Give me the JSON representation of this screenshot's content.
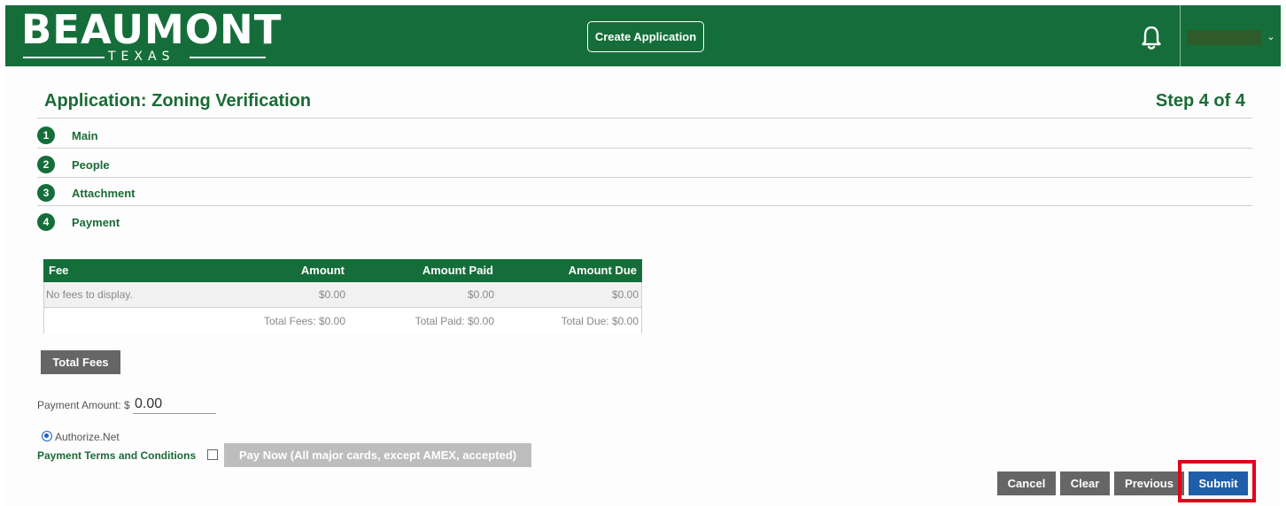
{
  "header": {
    "logo_word": "BEAUMONT",
    "logo_sub": "TEXAS",
    "create_label": "Create Application",
    "user_caret": "⌄"
  },
  "title": {
    "application": "Application: Zoning Verification",
    "step_count": "Step 4 of 4"
  },
  "steps": [
    {
      "number": "1",
      "label": "Main"
    },
    {
      "number": "2",
      "label": "People"
    },
    {
      "number": "3",
      "label": "Attachment"
    },
    {
      "number": "4",
      "label": "Payment"
    }
  ],
  "fees": {
    "columns": [
      "Fee",
      "Amount",
      "Amount Paid",
      "Amount Due"
    ],
    "row": {
      "fee": "No fees to display.",
      "amount": "$0.00",
      "paid": "$0.00",
      "due": "$0.00"
    },
    "totals": {
      "fees": "Total Fees: $0.00",
      "paid": "Total Paid: $0.00",
      "due": "Total Due: $0.00"
    }
  },
  "payment": {
    "total_fees_button": "Total Fees",
    "amount_label": "Payment Amount: $",
    "amount_value": "0.00",
    "method": "Authorize.Net",
    "terms_label": "Payment Terms and Conditions",
    "pay_now_label": "Pay Now (All major cards, except AMEX, accepted)"
  },
  "actions": {
    "cancel": "Cancel",
    "clear": "Clear",
    "previous": "Previous",
    "submit": "Submit"
  },
  "colors": {
    "brand_green": "#156e3a",
    "submit_blue": "#1f5ea8",
    "highlight_red": "#e0001b"
  }
}
